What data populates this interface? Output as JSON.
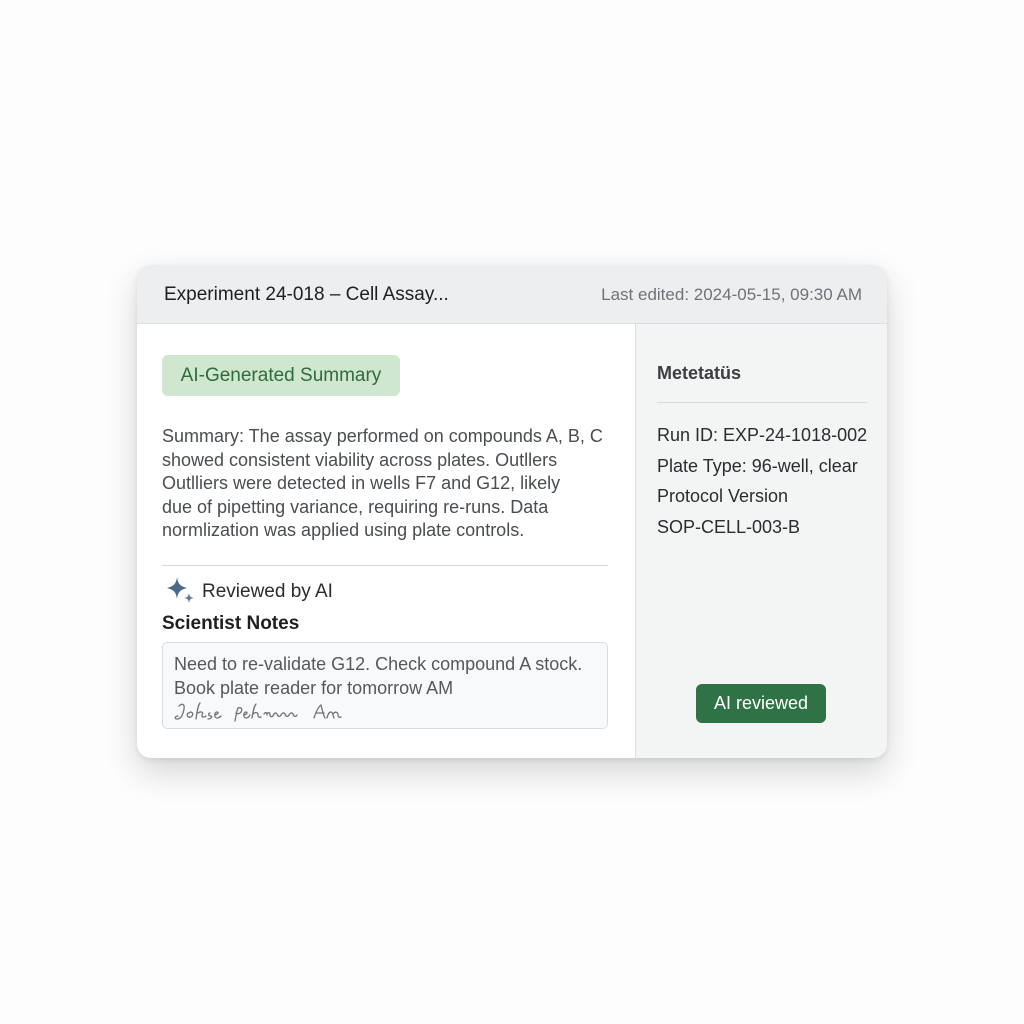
{
  "header": {
    "title": "Experiment 24-018 – Cell Assay...",
    "last_edited": "Last edited: 2024-05-15, 09:30 AM"
  },
  "summary": {
    "badge_label": "AI-Generated Summary",
    "lines": [
      "Summary: The assay performed on compounds A, B, C",
      "showed consistent viability across plates. Outllers",
      "Outlliers were detected in wells F7 and G12, likely",
      "due of pipetting variance, requiring re-runs. Data",
      "normlization was applied using plate controls."
    ],
    "reviewed_label": "Reviewed by AI",
    "reviewed_icon": "sparkle-icon"
  },
  "notes": {
    "heading": "Scientist Notes",
    "lines": [
      "Need to re-validate G12. Check compound A stock.",
      "Book plate reader for tomorrow AM"
    ],
    "signature": "Jokse  fehmmw  AM"
  },
  "metadata": {
    "heading": "Metetatüs",
    "items": [
      "Run ID: EXP-24-1018-002",
      "Plate Type: 96-well, clear",
      "Protocol Version",
      "SOP-CELL-003-B"
    ],
    "button_label": "AI reviewed"
  },
  "colors": {
    "badge_bg": "#cfe6cf",
    "badge_text": "#2f6b3e",
    "button_bg": "#2e7245",
    "sparkle": "#4a6a88"
  }
}
